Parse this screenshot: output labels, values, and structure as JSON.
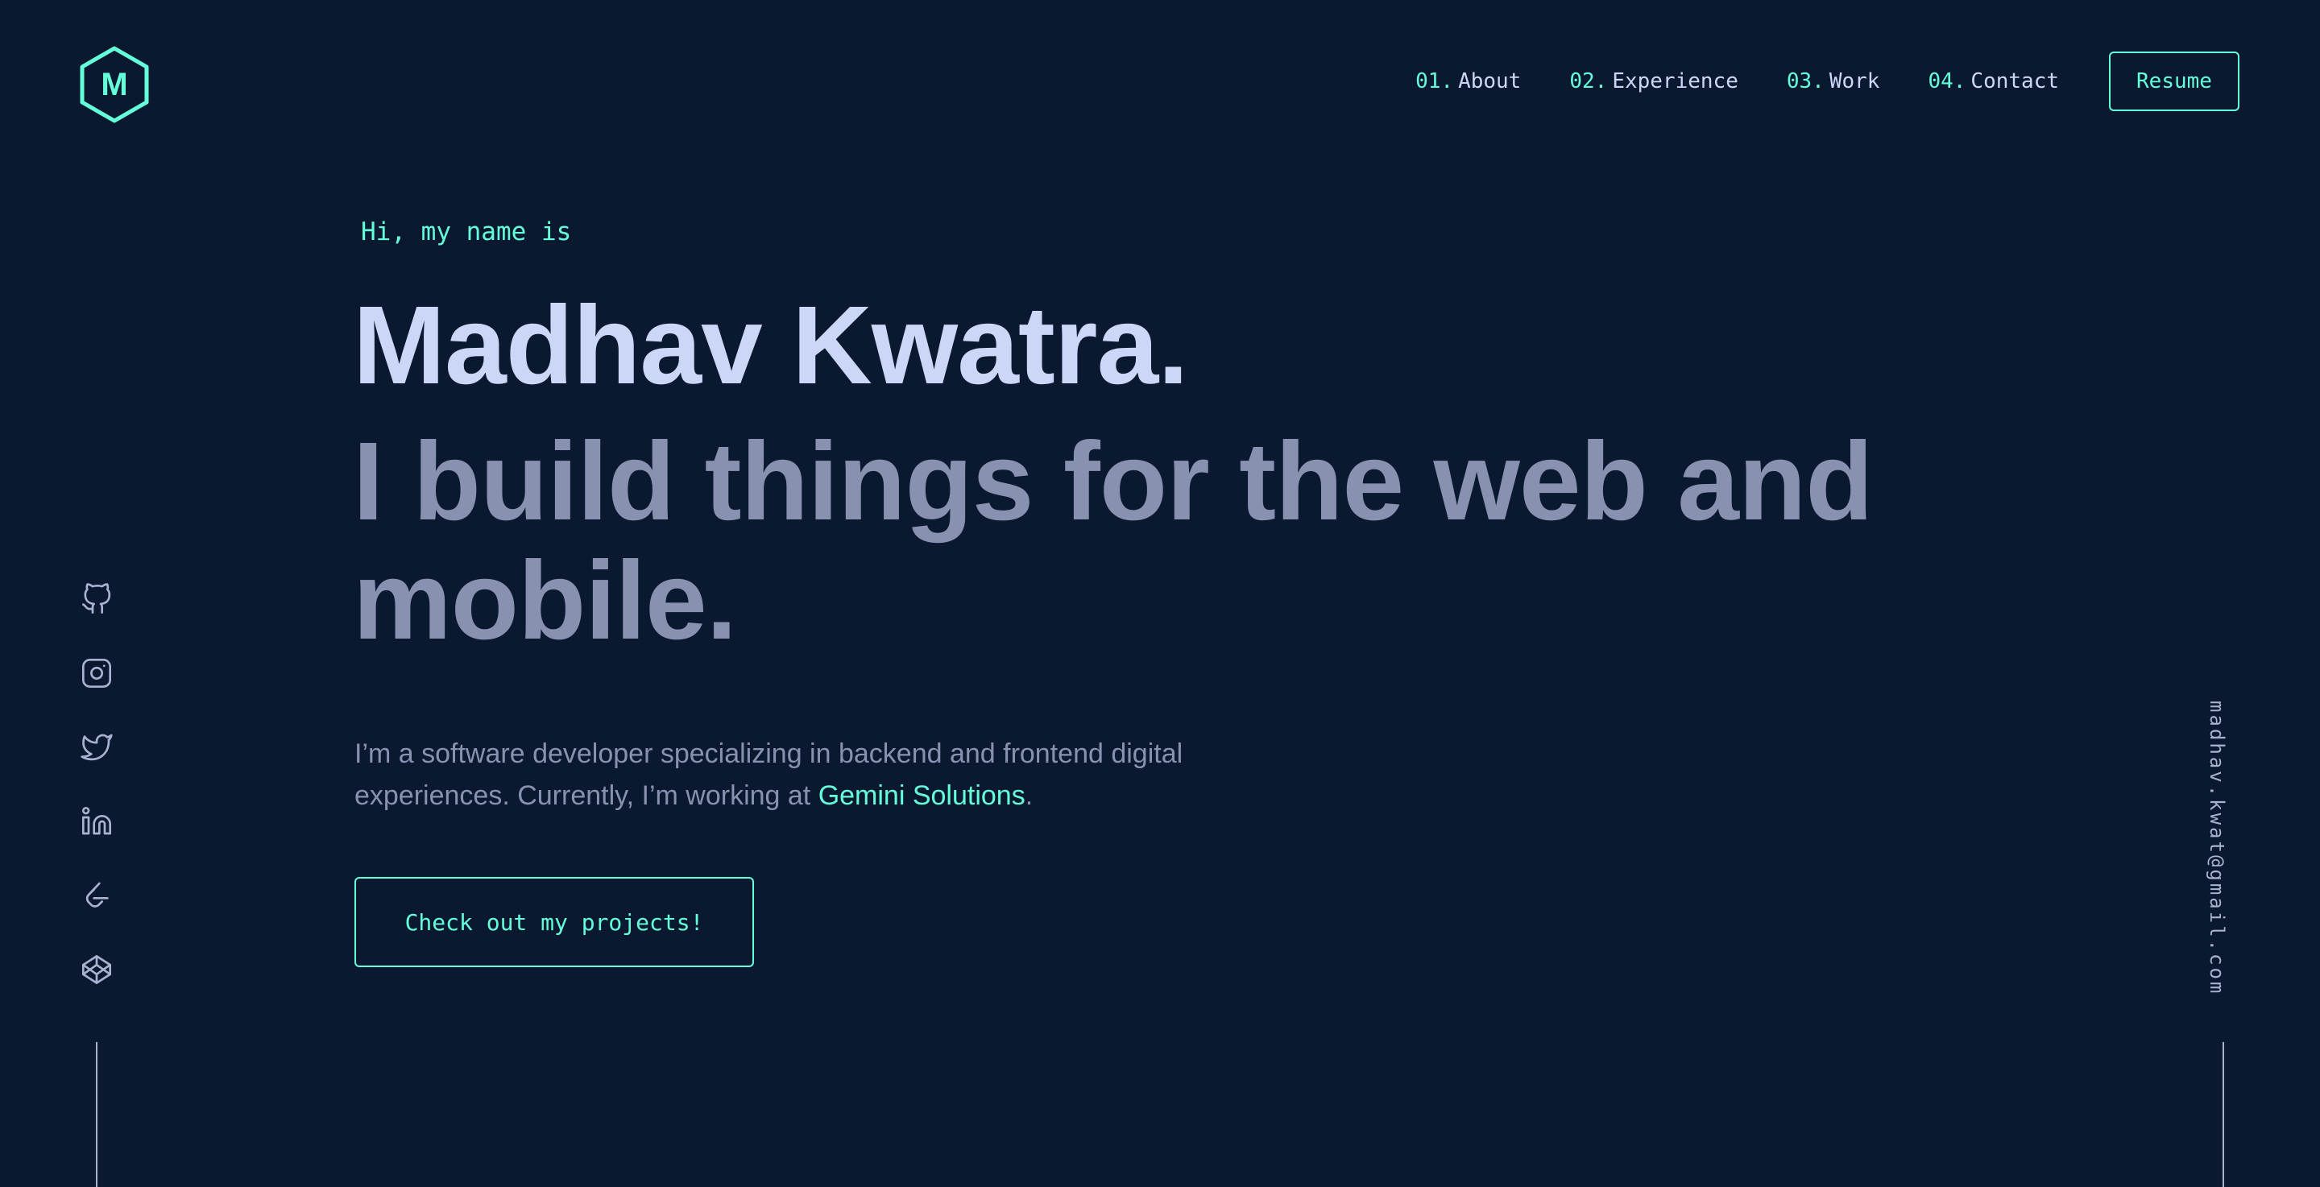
{
  "brand": {
    "logo_letter": "M"
  },
  "nav": {
    "items": [
      {
        "num": "01.",
        "label": "About"
      },
      {
        "num": "02.",
        "label": "Experience"
      },
      {
        "num": "03.",
        "label": "Work"
      },
      {
        "num": "04.",
        "label": "Contact"
      }
    ],
    "resume_label": "Resume"
  },
  "hero": {
    "greeting": "Hi, my name is",
    "name": "Madhav Kwatra.",
    "tagline": "I build things for the web and mobile.",
    "intro_part1": "I’m a software developer specializing in backend and frontend digital experiences. Currently, I’m working at ",
    "company": "Gemini Solutions",
    "intro_part2": ".",
    "cta_label": "Check out my projects!"
  },
  "social": {
    "icons": [
      "github-icon",
      "instagram-icon",
      "twitter-icon",
      "linkedin-icon",
      "leetcode-icon",
      "codepen-icon"
    ]
  },
  "email": "madhav.kwat@gmail.com",
  "colors": {
    "background": "#0a192f",
    "accent": "#64ffda",
    "heading": "#ccd6f6",
    "body_text": "#8892b0",
    "rail_text": "#a8b2d1"
  }
}
